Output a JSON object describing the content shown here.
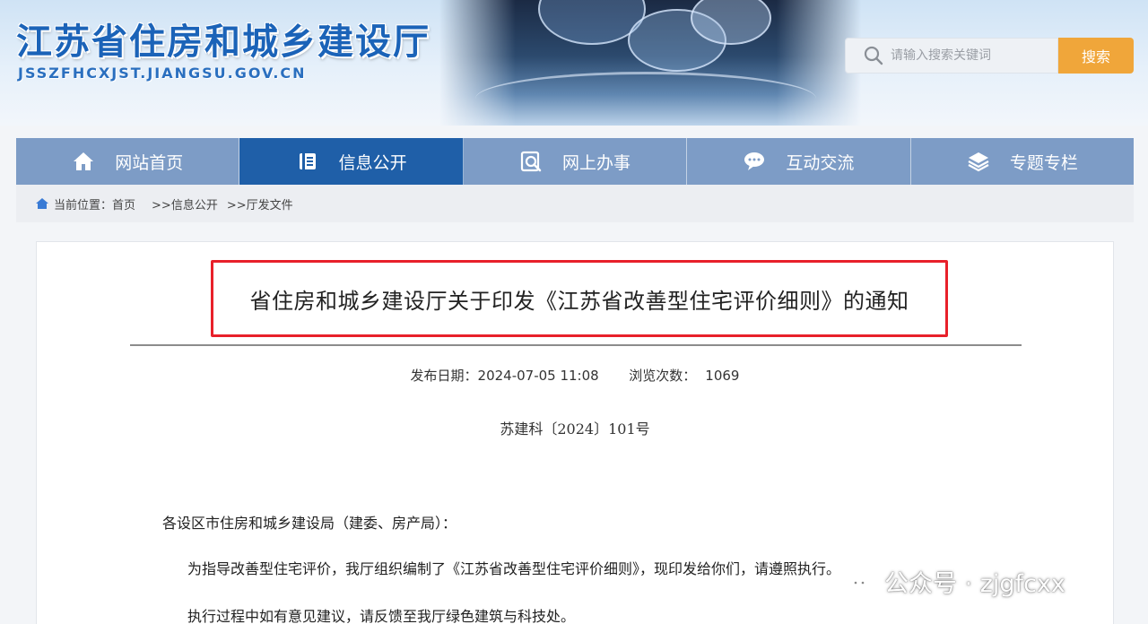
{
  "header": {
    "site_title": "江苏省住房和城乡建设厅",
    "site_domain": "JSSZFHCXJST.JIANGSU.GOV.CN",
    "search": {
      "placeholder": "请输入搜索关键词",
      "button_label": "搜索",
      "icon": "search-icon"
    }
  },
  "nav": {
    "items": [
      {
        "label": "网站首页",
        "icon": "home-icon",
        "active": false
      },
      {
        "label": "信息公开",
        "icon": "document-icon",
        "active": true
      },
      {
        "label": "网上办事",
        "icon": "online-service-icon",
        "active": false
      },
      {
        "label": "互动交流",
        "icon": "chat-icon",
        "active": false
      },
      {
        "label": "专题专栏",
        "icon": "layers-icon",
        "active": false
      }
    ],
    "colors": {
      "bar": "#7d9cc6",
      "active": "#1f5fa8"
    }
  },
  "breadcrumb": {
    "prefix": "当前位置：",
    "items": [
      "首页",
      ">>信息公开",
      ">>厅发文件"
    ]
  },
  "article": {
    "title": "省住房和城乡建设厅关于印发《江苏省改善型住宅评价细则》的通知",
    "publish_label": "发布日期：",
    "publish_date": "2024-07-05 11:08",
    "views_label": "浏览次数：",
    "views": "1069",
    "doc_number": "苏建科〔2024〕101号",
    "salutation": "各设区市住房和城乡建设局（建委、房产局）：",
    "paragraphs": [
      "为指导改善型住宅评价，我厅组织编制了《江苏省改善型住宅评价细则》，现印发给你们，请遵照执行。",
      "执行过程中如有意见建议，请反馈至我厅绿色建筑与科技处。"
    ],
    "highlight_color": "#e8202a"
  },
  "watermark": {
    "icon": "wechat-icon",
    "text": "公众号 · zjgfcxx"
  }
}
